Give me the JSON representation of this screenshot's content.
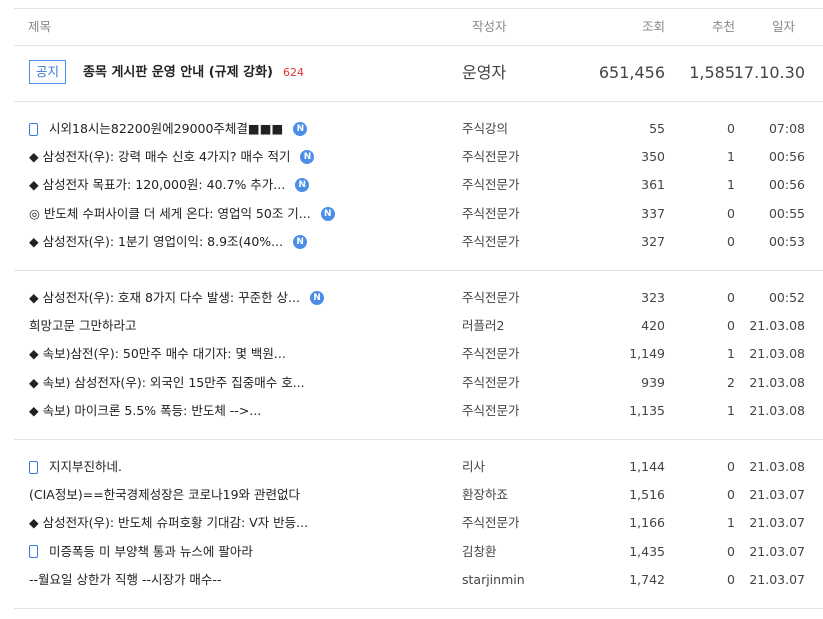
{
  "header": {
    "title": "제목",
    "author": "작성자",
    "views": "조회",
    "recommend": "추천",
    "date": "일자"
  },
  "notice": {
    "badge": "공지",
    "title": "종목 게시판 운영 안내 (규제 강화)",
    "comment_count": "624",
    "author": "운영자",
    "views": "651,456",
    "recommend": "1,585",
    "date": "17.10.30"
  },
  "groups": [
    [
      {
        "title": "시외18시는82200원에29000주체결■■■",
        "mobile": true,
        "new": true,
        "author": "주식강의",
        "views": "55",
        "recommend": "0",
        "date": "07:08"
      },
      {
        "title": "◆ 삼성전자(우): 강력 매수 신호 4가지? 매수 적기",
        "mobile": false,
        "new": true,
        "author": "주식전문가",
        "views": "350",
        "recommend": "1",
        "date": "00:56"
      },
      {
        "title": "◆ 삼성전자 목표가: 120,000원: 40.7% 추가...",
        "mobile": false,
        "new": true,
        "author": "주식전문가",
        "views": "361",
        "recommend": "1",
        "date": "00:56"
      },
      {
        "title": "◎ 반도체 수퍼사이클 더 세게 온다: 영업익 50조 기...",
        "mobile": false,
        "new": true,
        "author": "주식전문가",
        "views": "337",
        "recommend": "0",
        "date": "00:55"
      },
      {
        "title": "◆ 삼성전자(우): 1분기 영업이익: 8.9조(40%...",
        "mobile": false,
        "new": true,
        "author": "주식전문가",
        "views": "327",
        "recommend": "0",
        "date": "00:53"
      }
    ],
    [
      {
        "title": "◆ 삼성전자(우): 호재 8가지 다수 발생: 꾸준한 상...",
        "mobile": false,
        "new": true,
        "author": "주식전문가",
        "views": "323",
        "recommend": "0",
        "date": "00:52"
      },
      {
        "title": "희망고문 그만하라고",
        "mobile": false,
        "new": false,
        "author": "러플러2",
        "views": "420",
        "recommend": "0",
        "date": "21.03.08"
      },
      {
        "title": "◆ 속보)삼전(우): 50만주 매수 대기자: 몇 백원...",
        "mobile": false,
        "new": false,
        "author": "주식전문가",
        "views": "1,149",
        "recommend": "1",
        "date": "21.03.08"
      },
      {
        "title": "◆ 속보) 삼성전자(우): 외국인 15만주 집중매수 호...",
        "mobile": false,
        "new": false,
        "author": "주식전문가",
        "views": "939",
        "recommend": "2",
        "date": "21.03.08"
      },
      {
        "title": "◆ 속보) 마이크론 5.5% 폭등: 반도체 -->...",
        "mobile": false,
        "new": false,
        "author": "주식전문가",
        "views": "1,135",
        "recommend": "1",
        "date": "21.03.08"
      }
    ],
    [
      {
        "title": "지지부진하네.",
        "mobile": true,
        "new": false,
        "author": "리사",
        "views": "1,144",
        "recommend": "0",
        "date": "21.03.08"
      },
      {
        "title": "(CIA정보)==한국경제성장은 코로나19와 관련없다",
        "mobile": false,
        "new": false,
        "author": "환장하죠",
        "views": "1,516",
        "recommend": "0",
        "date": "21.03.07"
      },
      {
        "title": "◆ 삼성전자(우): 반도체 슈퍼호황 기대감: V자 반등...",
        "mobile": false,
        "new": false,
        "author": "주식전문가",
        "views": "1,166",
        "recommend": "1",
        "date": "21.03.07"
      },
      {
        "title": "미증폭등 미 부양책 통과 뉴스에 팔아라",
        "mobile": true,
        "new": false,
        "author": "김창환",
        "views": "1,435",
        "recommend": "0",
        "date": "21.03.07"
      },
      {
        "title": "--월요일 상한가 직행 --시장가 매수--",
        "mobile": false,
        "new": false,
        "author": "starjinmin",
        "views": "1,742",
        "recommend": "0",
        "date": "21.03.07"
      }
    ]
  ],
  "new_badge_label": "N",
  "colors": {
    "accent": "#3a78d8",
    "comment_count": "#e0322f",
    "divider": "#e3e3e3"
  }
}
